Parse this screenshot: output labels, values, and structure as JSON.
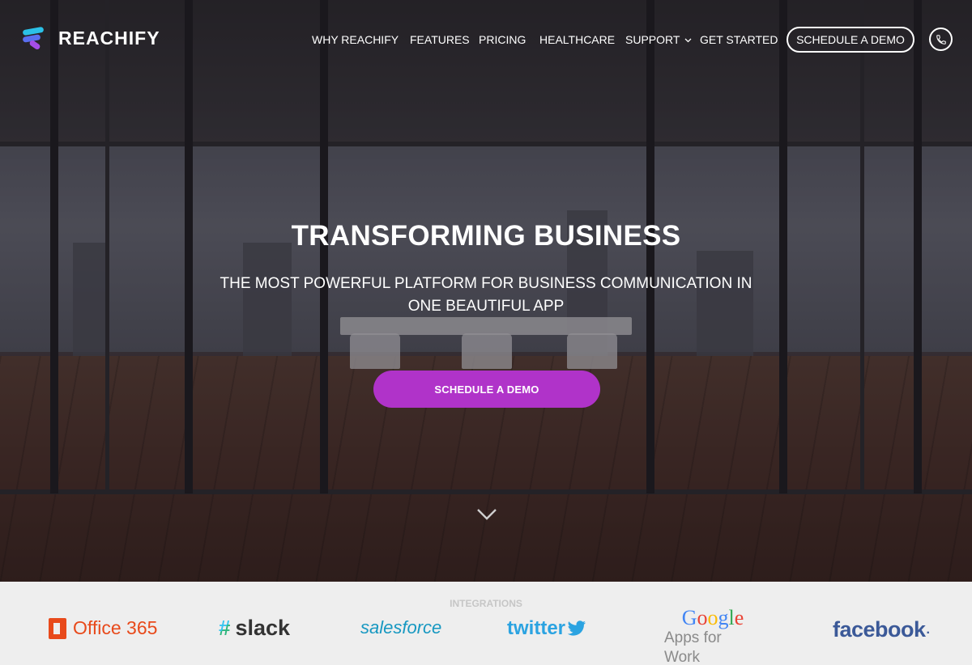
{
  "brand": {
    "name": "REACHIFY"
  },
  "nav": {
    "items": [
      {
        "label": "WHY REACHIFY"
      },
      {
        "label": "FEATURES"
      },
      {
        "label": "PRICING"
      },
      {
        "label": "HEALTHCARE"
      },
      {
        "label": "SUPPORT"
      },
      {
        "label": "GET STARTED"
      }
    ],
    "demo_button": "SCHEDULE A DEMO",
    "phone_icon": "phone-icon",
    "support_icon": "chevron-down-icon"
  },
  "hero": {
    "headline": "TRANSFORMING BUSINESS",
    "subline": "THE MOST POWERFUL PLATFORM FOR BUSINESS COMMUNICATION IN ONE BEAUTIFUL APP",
    "cta_label": "SCHEDULE A DEMO",
    "cta_color": "#b033c9",
    "scroll_icon": "chevron-down-icon"
  },
  "integrations": {
    "title": "INTEGRATIONS",
    "logos": [
      {
        "name": "Office 365",
        "color": "#e84a1b"
      },
      {
        "name": "slack",
        "color": "#333333"
      },
      {
        "name": "salesforce",
        "color": "#1798c1"
      },
      {
        "name": "twitter",
        "color": "#2ba3e1"
      },
      {
        "name": "Google",
        "sub": "Apps for Work"
      },
      {
        "name": "facebook",
        "color": "#3b5998"
      }
    ]
  }
}
